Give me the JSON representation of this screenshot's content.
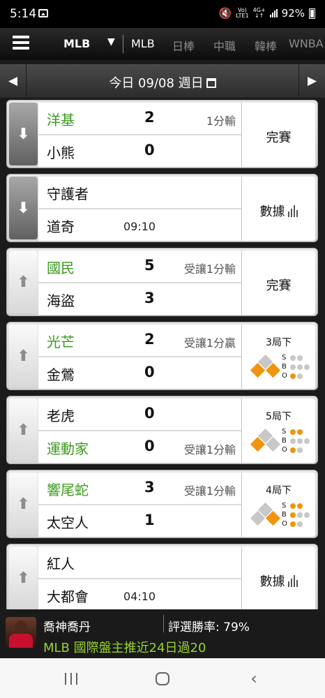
{
  "status_bar": {
    "time": "5:14",
    "volte_top": "Vo)",
    "volte_bottom": "LTE1",
    "network_top": "4G+",
    "network_bottom": "↓↑",
    "battery": "92%"
  },
  "nav": {
    "selected": "MLB",
    "tabs": [
      {
        "label": "MLB",
        "active": true
      },
      {
        "label": "日棒",
        "active": false
      },
      {
        "label": "中職",
        "active": false
      },
      {
        "label": "韓棒",
        "active": false
      },
      {
        "label": "WNBA",
        "active": false
      }
    ]
  },
  "date_bar": {
    "label": "今日 09/08 週日"
  },
  "games": [
    {
      "away": {
        "name": "洋基",
        "score": "2",
        "highlight": true
      },
      "home": {
        "name": "小熊",
        "score": "0",
        "highlight": false
      },
      "note": "1分輸",
      "time": "",
      "status": "完賽",
      "fav": "down"
    },
    {
      "away": {
        "name": "守護者",
        "score": "",
        "highlight": false
      },
      "home": {
        "name": "道奇",
        "score": "",
        "highlight": false
      },
      "note": "",
      "time": "09:10",
      "status": "數據",
      "fav": "down"
    },
    {
      "away": {
        "name": "國民",
        "score": "5",
        "highlight": true
      },
      "home": {
        "name": "海盜",
        "score": "3",
        "highlight": false
      },
      "note": "受讓1分輸",
      "time": "",
      "status": "完賽",
      "fav": "up"
    },
    {
      "away": {
        "name": "光芒",
        "score": "2",
        "highlight": true
      },
      "home": {
        "name": "金鶯",
        "score": "0",
        "highlight": false
      },
      "note": "受讓1分贏",
      "time": "",
      "status": "live",
      "inning": "3局下",
      "bases": {
        "first": true,
        "second": false,
        "third": true
      },
      "count": {
        "S": 0,
        "B": 0,
        "O": 1
      },
      "fav": "up"
    },
    {
      "away": {
        "name": "老虎",
        "score": "0",
        "highlight": false
      },
      "home": {
        "name": "運動家",
        "score": "0",
        "highlight": true
      },
      "note": "受讓1分輸",
      "note_row": 2,
      "time": "",
      "status": "live",
      "inning": "5局下",
      "bases": {
        "first": false,
        "second": false,
        "third": true
      },
      "count": {
        "S": 2,
        "B": 0,
        "O": 1
      },
      "fav": "up"
    },
    {
      "away": {
        "name": "響尾蛇",
        "score": "3",
        "highlight": true
      },
      "home": {
        "name": "太空人",
        "score": "1",
        "highlight": false
      },
      "note": "受讓1分輸",
      "time": "",
      "status": "live",
      "inning": "4局下",
      "bases": {
        "first": true,
        "second": false,
        "third": false
      },
      "count": {
        "S": 2,
        "B": 1,
        "O": 1
      },
      "fav": "up"
    },
    {
      "away": {
        "name": "紅人",
        "score": "",
        "highlight": false
      },
      "home": {
        "name": "大都會",
        "score": "",
        "highlight": false
      },
      "note": "",
      "time": "04:10",
      "status": "數據",
      "fav": "up"
    }
  ],
  "count_labels": {
    "S": "S",
    "B": "B",
    "O": "O"
  },
  "promo": {
    "expert": "喬神喬丹",
    "rate": "評選勝率: 79%",
    "headline": "MLB 國際盤主推近24日過20"
  },
  "colors": {
    "accent_green": "#3a9a1c",
    "runner_orange": "#f09410",
    "promo_green": "#9ad22a"
  }
}
